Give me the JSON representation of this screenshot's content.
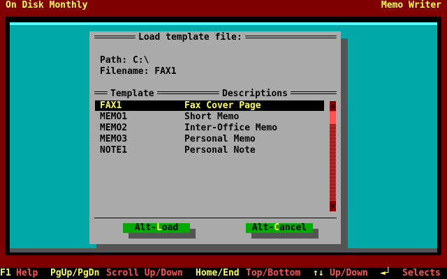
{
  "header": {
    "title": "On Disk Monthly",
    "app": "Memo Writer"
  },
  "dialog": {
    "title": "Load template file:",
    "path_label": "Path: C:\\",
    "filename_label": "Filename: FAX1",
    "col_template": "Template",
    "col_descriptions": "Descriptions",
    "rows": [
      {
        "template": "FAX1",
        "description": "Fax Cover Page",
        "selected": true
      },
      {
        "template": "MEMO1",
        "description": "Short Memo"
      },
      {
        "template": "MEMO2",
        "description": "Inter-Office Memo"
      },
      {
        "template": "MEMO3",
        "description": "Personal Memo"
      },
      {
        "template": "NOTE1",
        "description": "Personal Note"
      }
    ],
    "load_button": {
      "prefix": "Alt-",
      "hot": "L",
      "rest": "oad"
    },
    "cancel_button": {
      "prefix": "Alt-",
      "hot": "C",
      "rest": "ancel"
    }
  },
  "statusbar": {
    "items": [
      {
        "key": "F1",
        "action": "Help"
      },
      {
        "key": "PgUp/PgDn",
        "action": "Scroll Up/Down"
      },
      {
        "key": "Home/End",
        "action": "Top/Bottom"
      },
      {
        "key": "↑↓",
        "action": "Up/Down"
      },
      {
        "key": "◄┘",
        "action": "Selects"
      }
    ]
  },
  "colors": {
    "frame": "#800000",
    "desktop": "#00a8a8",
    "dialog": "#aaaaaa",
    "highlight_text": "#ffff55",
    "button": "#00aa00",
    "status_action": "#ff5555"
  },
  "icons": [
    "scroll-up-arrow-icon",
    "scroll-down-arrow-icon",
    "enter-key-icon"
  ]
}
